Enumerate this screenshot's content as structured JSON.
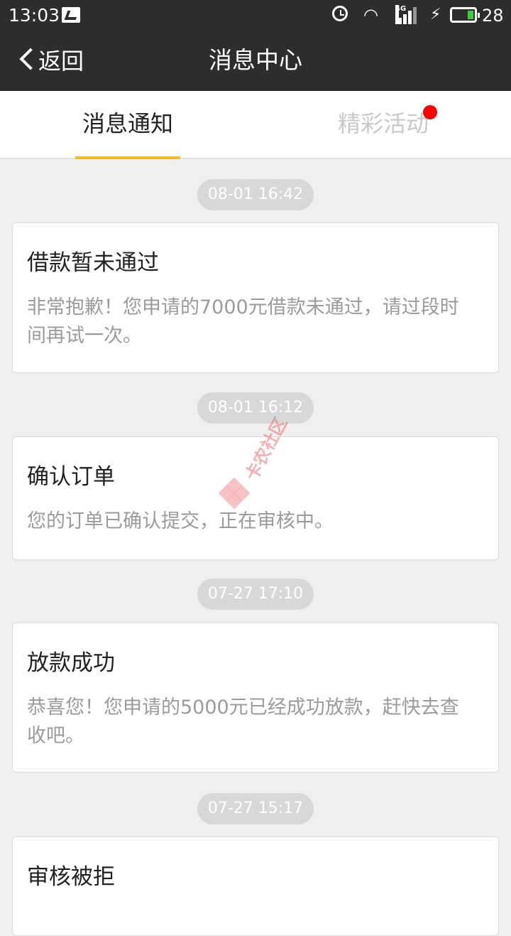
{
  "status_bar": {
    "time": "13:03",
    "notification_icon": "image-notification-icon",
    "alarm_icon": "alarm-clock-icon",
    "wifi_icon": "wifi-icon",
    "network_label": "4G",
    "signal_icon": "signal-bars-icon",
    "charging_icon": "lightning-bolt-icon",
    "battery_icon": "battery-icon",
    "battery_level": 0.28,
    "battery_percent": "28",
    "battery_color": "#3ecb3e"
  },
  "header": {
    "back_label": "返回",
    "back_icon": "chevron-left-icon",
    "title": "消息中心",
    "background": "#2c2d2c"
  },
  "tabs": [
    {
      "label": "消息通知",
      "active": true
    },
    {
      "label": "精彩活动",
      "active": false,
      "has_badge": true
    }
  ],
  "accent_color": "#f3bb1c",
  "badge_color": "#ff0000",
  "messages": [
    {
      "time": "08-01 16:42",
      "title": "借款暂未通过",
      "body": "非常抱歉！您申请的7000元借款未通过，请过段时间再试一次。"
    },
    {
      "time": "08-01 16:12",
      "title": "确认订单",
      "body": "您的订单已确认提交，正在审核中。"
    },
    {
      "time": "07-27 17:10",
      "title": "放款成功",
      "body": "恭喜您！您申请的5000元已经成功放款，赶快去查收吧。"
    },
    {
      "time": "07-27 15:17",
      "title": "审核被拒",
      "body": ""
    }
  ],
  "watermark": {
    "text": "卡农社区"
  }
}
